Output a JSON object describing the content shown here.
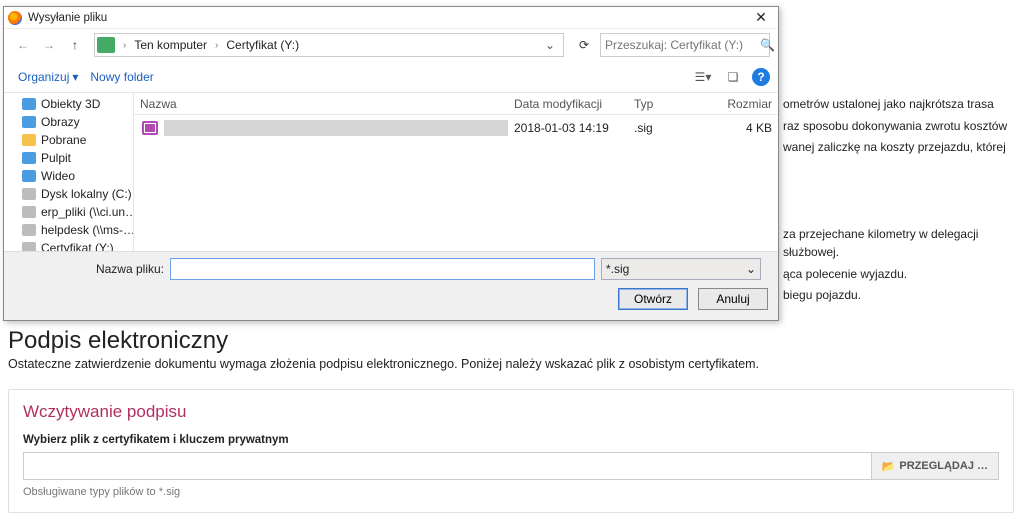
{
  "dialog": {
    "title": "Wysyłanie pliku",
    "nav": {
      "back": "←",
      "fwd": "→",
      "up": "↑"
    },
    "breadcrumb": {
      "seg1": "Ten komputer",
      "seg2": "Certyfikat (Y:)"
    },
    "search": {
      "placeholder": "Przeszukaj: Certyfikat (Y:)"
    },
    "toolbar": {
      "organize": "Organizuj",
      "newfolder": "Nowy folder"
    },
    "columns": {
      "name": "Nazwa",
      "modified": "Data modyfikacji",
      "type": "Typ",
      "size": "Rozmiar"
    },
    "tree": {
      "i0": "Obiekty 3D",
      "i1": "Obrazy",
      "i2": "Pobrane",
      "i3": "Pulpit",
      "i4": "Wideo",
      "i5": "Dysk lokalny (C:)",
      "i6": "erp_pliki (\\\\ci.un…",
      "i7": "helpdesk (\\\\ms-…",
      "i8": "Certyfikat (Y:)"
    },
    "row": {
      "modified": "2018-01-03 14:19",
      "type": ".sig",
      "size": "4 KB"
    },
    "filename_label": "Nazwa pliku:",
    "filter": "*.sig",
    "open": "Otwórz",
    "cancel": "Anuluj"
  },
  "bg": {
    "l1": "ometrów ustalonej jako najkrótsza trasa",
    "l2": "raz sposobu dokonywania zwrotu kosztów",
    "l3": "wanej zaliczkę na koszty przejazdu, której",
    "l4": "za przejechane kilometry w delegacji służbowej.",
    "l5": "ąca polecenie wyjazdu.",
    "l6": "biegu pojazdu."
  },
  "sig": {
    "h1": "Podpis elektroniczny",
    "sub": "Ostateczne zatwierdzenie dokumentu wymaga złożenia podpisu elektronicznego. Poniżej należy wskazać plik z osobistym certyfikatem.",
    "h2": "Wczytywanie podpisu",
    "lbl": "Wybierz plik z certyfikatem i kluczem prywatnym",
    "browse": "PRZEGLĄDAJ …",
    "hint": "Obsługiwane typy plików to *.sig"
  }
}
